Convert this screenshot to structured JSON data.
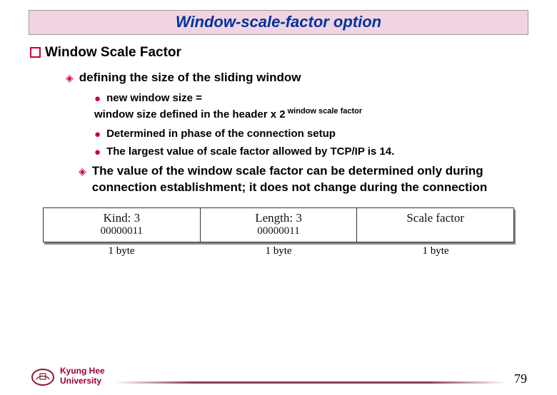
{
  "title": "Window-scale-factor option",
  "heading": "Window Scale Factor",
  "sub1": "defining the size of the sliding window",
  "bullets": {
    "b1a": "new window size =",
    "b1b_prefix": "window size defined in the header x 2",
    "b1b_sup": " window scale factor",
    "b2": "Determined in phase of the connection setup",
    "b3": "The largest value of scale factor allowed by TCP/IP is 14."
  },
  "para": "The value of the window scale factor can be determined only during connection establishment; it does not change during the connection",
  "diagram": {
    "cells": [
      {
        "top": "Kind: 3",
        "bot": "00000011",
        "label": "1 byte"
      },
      {
        "top": "Length: 3",
        "bot": "00000011",
        "label": "1 byte"
      },
      {
        "top": "Scale factor",
        "bot": "",
        "label": "1 byte"
      }
    ]
  },
  "footer": {
    "university_l1": "Kyung Hee",
    "university_l2": "University",
    "page": "79"
  }
}
